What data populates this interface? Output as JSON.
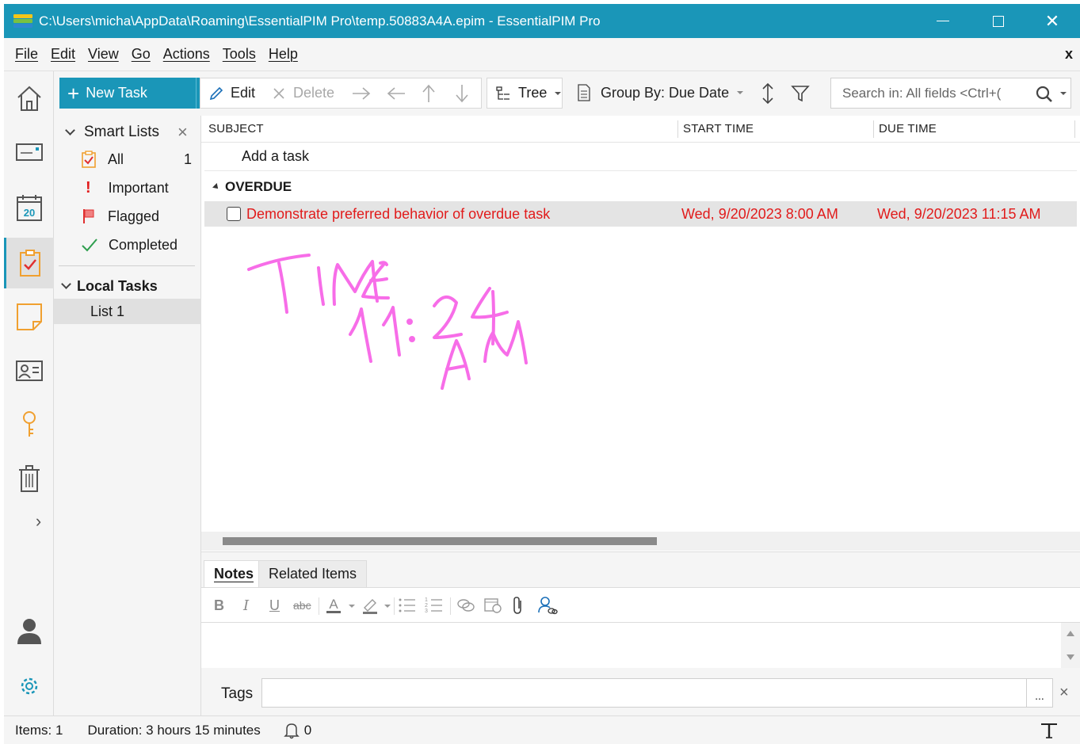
{
  "window": {
    "title": "C:\\Users\\micha\\AppData\\Roaming\\EssentialPIM Pro\\temp.50883A4A.epim - EssentialPIM Pro",
    "icon": "essentialpim-logo-icon",
    "close_glyph": "✕"
  },
  "menu": {
    "items": [
      "File",
      "Edit",
      "View",
      "Go",
      "Actions",
      "Tools",
      "Help"
    ],
    "close_glyph": "x"
  },
  "nav": {
    "items": [
      "home-icon",
      "mail-icon",
      "calendar-icon",
      "tasks-icon",
      "notes-icon",
      "contacts-icon",
      "passwords-icon",
      "trash-icon",
      "expand-icon",
      "account-icon",
      "settings-icon"
    ],
    "calendar_day": "20",
    "active": "tasks",
    "expand_glyph": "›"
  },
  "toolbar": {
    "new_task": "New Task",
    "edit": "Edit",
    "delete": "Delete",
    "tree": "Tree",
    "group_by": "Group By: Due Date",
    "search_placeholder": "Search in: All fields  <Ctrl+("
  },
  "smart_lists": {
    "header": "Smart Lists",
    "close_glyph": "×",
    "items": [
      {
        "label": "All",
        "count": "1",
        "icon": "clipboard-check-icon"
      },
      {
        "label": "Important",
        "icon": "exclamation-icon"
      },
      {
        "label": "Flagged",
        "icon": "flag-icon"
      },
      {
        "label": "Completed",
        "icon": "checkmark-icon"
      }
    ]
  },
  "local_tasks": {
    "header": "Local Tasks",
    "items": [
      {
        "label": "List 1"
      }
    ]
  },
  "grid": {
    "columns": [
      "SUBJECT",
      "START TIME",
      "DUE TIME"
    ],
    "add_task": "Add a task",
    "group_label": "OVERDUE",
    "tasks": [
      {
        "subject": "Demonstrate preferred behavior of overdue task",
        "start": "Wed, 9/20/2023 8:00 AM",
        "due": "Wed, 9/20/2023 11:15 AM",
        "color": "#e11b1b"
      }
    ]
  },
  "notes_panel": {
    "tabs": [
      "Notes",
      "Related Items"
    ],
    "active_tab": "Notes",
    "tags_label": "Tags",
    "tags_button": "...",
    "tags_clear_glyph": "×"
  },
  "status": {
    "items": "Items: 1",
    "duration": "Duration: 3 hours 15 minutes",
    "reminders": "0"
  },
  "ink_annotation": {
    "text": "TIME 11:24 AM",
    "color": "#f76de8"
  },
  "colors": {
    "accent": "#1a96b8",
    "overdue": "#e11b1b",
    "ink": "#f76de8"
  }
}
